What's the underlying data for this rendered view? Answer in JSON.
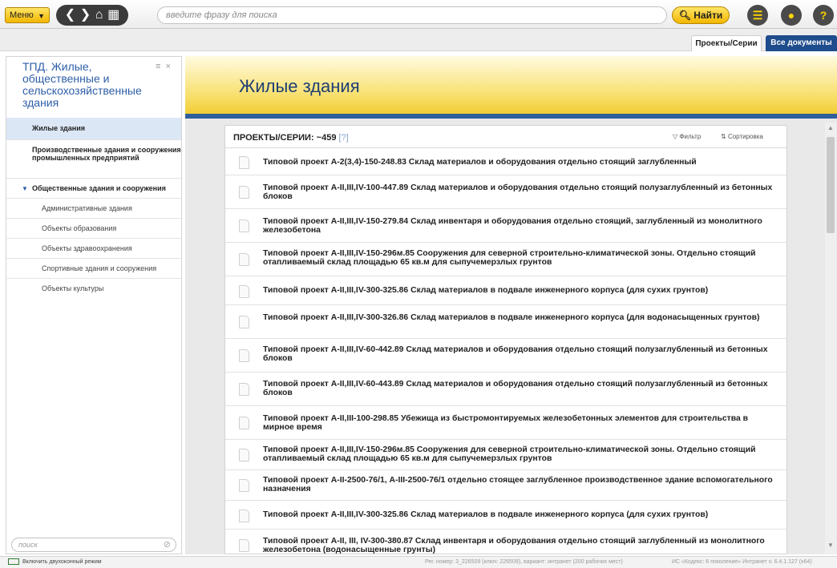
{
  "toolbar": {
    "menu_label": "Меню",
    "search_placeholder": "введите фразу для поиска",
    "find_label": "Найти"
  },
  "tabs": [
    {
      "label": "Проекты/Серии",
      "active": true
    },
    {
      "label": "Все документы",
      "active": false
    }
  ],
  "sidebar": {
    "title": "ТПД. Жилые, общественные и сельскохозяйственные здания",
    "items": [
      {
        "label": "Жилые здания",
        "selected": true
      },
      {
        "label": "Производственные здания и сооружения промышленных предприятий"
      },
      {
        "label": "Общественные здания и сооружения",
        "expanded": true
      },
      {
        "label": "Административные здания"
      },
      {
        "label": "Объекты образования"
      },
      {
        "label": "Объекты здравоохранения"
      },
      {
        "label": "Спортивные здания и сооружения"
      },
      {
        "label": "Объекты культуры"
      }
    ],
    "search_placeholder": "поиск"
  },
  "main": {
    "heading": "Жилые здания",
    "list_title": "ПРОЕКТЫ/СЕРИИ: ~459",
    "help": "[?]",
    "filter_label": "Фильтр",
    "sort_label": "Сортировка"
  },
  "documents": [
    "Типовой проект А-2(3,4)-150-248.83 Склад материалов и оборудования отдельно стоящий заглубленный",
    "Типовой проект А-II,III,IV-100-447.89 Склад материалов и оборудования отдельно стоящий полузаглубленный из бетонных блоков",
    "Типовой проект А-II,III,IV-150-279.84 Склад инвентаря и оборудования отдельно стоящий, заглубленный из монолитного железобетона",
    "Типовой проект А-II,III,IV-150-296м.85 Сооружения для северной строительно-климатической зоны. Отдельно стоящий отапливаемый склад площадью 65 кв.м для сыпучемерзлых грунтов",
    "Типовой проект А-II,III,IV-300-325.86 Склад материалов в подвале инженерного корпуса (для сухих грунтов)",
    "Типовой проект А-II,III,IV-300-326.86 Склад материалов в подвале инженерного корпуса (для водонасыщенных грунтов)",
    "Типовой проект А-II,III,IV-60-442.89 Склад материалов и оборудования отдельно стоящий полузаглубленный из бетонных блоков",
    "Типовой проект А-II,III,IV-60-443.89 Склад материалов и оборудования отдельно стоящий полузаглубленный из бетонных блоков",
    "Типовой проект А-II,III-100-298.85 Убежища из быстромонтируемых железобетонных элементов для строительства в мирное время",
    "Типовой проект А-II,III,IV-150-296м.85 Сооружения для северной строительно-климатической зоны. Отдельно стоящий отапливаемый склад площадью 65 кв.м для сыпучемерзлых грунтов",
    "Типовой проект А-II-2500-76/1, А-III-2500-76/1 отдельно стоящее заглубленное производственное здание вспомогательного назначения",
    "Типовой проект А-II,III,IV-300-325.86 Склад материалов в подвале инженерного корпуса (для сухих грунтов)",
    "Типовой проект А-II, III, IV-300-380.87 Склад инвентаря и оборудования отдельно стоящий заглубленный из монолитного железобетона (водонасыщенные грунты)"
  ],
  "status": {
    "dual_mode": "Включить двухоконный режим",
    "reg": "Рег. номер: 3_226509 (ключ: 226509), вариант: интранет (200 рабочих мест)",
    "version": "ИС «Кодекс: 6 поколение» Интранет v. 6.4.1.127 (x64)"
  }
}
